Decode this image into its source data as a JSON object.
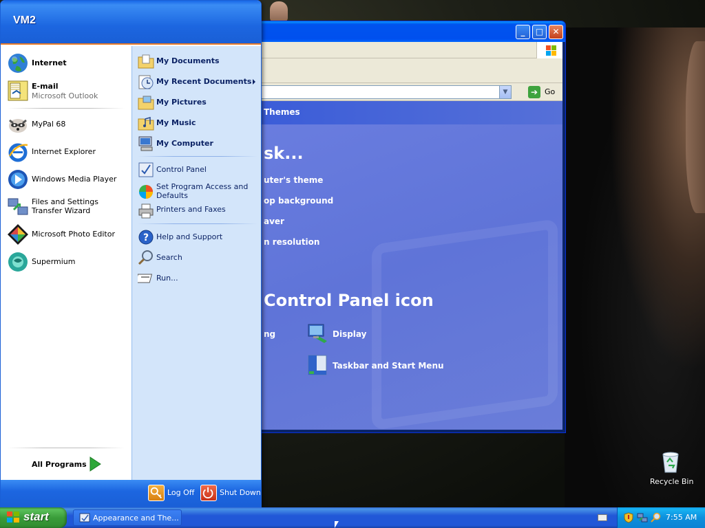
{
  "start_menu": {
    "user": "VM2",
    "pinned": [
      {
        "label": "Internet"
      },
      {
        "label": "E-mail",
        "sub": "Microsoft Outlook"
      }
    ],
    "recent": [
      {
        "label": "MyPal 68"
      },
      {
        "label": "Internet Explorer"
      },
      {
        "label": "Windows Media Player"
      },
      {
        "label": "Files and Settings Transfer Wizard"
      },
      {
        "label": "Microsoft Photo Editor"
      },
      {
        "label": "Supermium"
      }
    ],
    "all_programs": "All Programs",
    "right": [
      {
        "label": "My Documents"
      },
      {
        "label": "My Recent Documents"
      },
      {
        "label": "My Pictures"
      },
      {
        "label": "My Music"
      },
      {
        "label": "My Computer"
      },
      {
        "label": "Control Panel"
      },
      {
        "label": "Set Program Access and Defaults"
      },
      {
        "label": "Printers and Faxes"
      },
      {
        "label": "Help and Support"
      },
      {
        "label": "Search"
      },
      {
        "label": "Run..."
      }
    ],
    "logoff": "Log Off",
    "shutdown": "Shut Down"
  },
  "window": {
    "address_go": "Go",
    "themes": "Themes",
    "pick_task": "sk...",
    "tasks": [
      "uter's theme",
      "op background",
      "aver",
      "n resolution"
    ],
    "pick_icon": "Control Panel icon",
    "icon_left_partial": "ng",
    "icons": [
      "Display",
      "Taskbar and Start Menu"
    ]
  },
  "taskbar": {
    "start": "start",
    "task_label": "Appearance and The...",
    "clock": "7:55 AM"
  },
  "desktop": {
    "recycle_bin": "Recycle Bin"
  }
}
